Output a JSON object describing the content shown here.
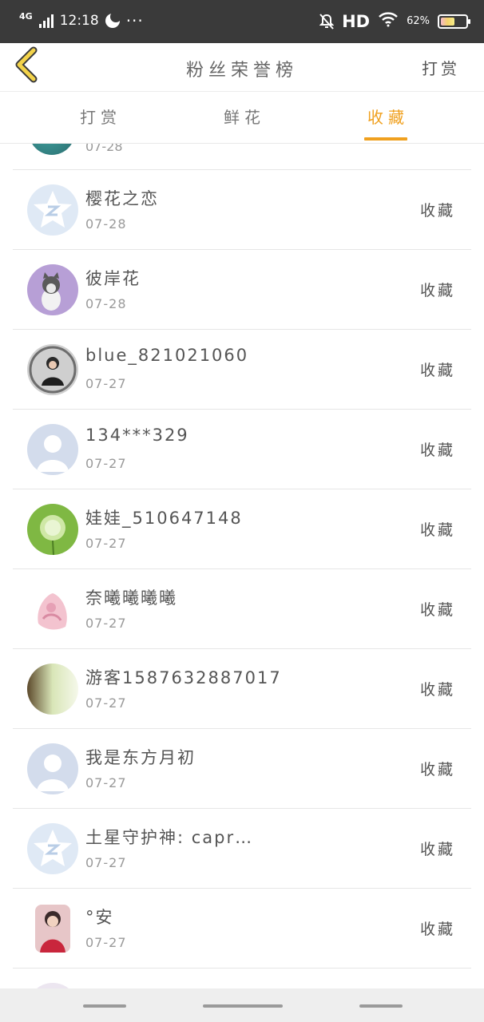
{
  "status_bar": {
    "network": "4G",
    "time": "12:18",
    "dots": "···",
    "hd": "HD",
    "battery_pct": "62%",
    "battery_level": 0.62
  },
  "header": {
    "title": "粉丝荣誉榜",
    "action": "打赏"
  },
  "tabs": [
    "打赏",
    "鲜花",
    "收藏"
  ],
  "active_tab": "收藏",
  "partial_top_date": "07-28",
  "rows": [
    {
      "name": "樱花之恋",
      "date": "07-28",
      "action": "收藏"
    },
    {
      "name": "彼岸花",
      "date": "07-28",
      "action": "收藏"
    },
    {
      "name": "blue_821021060",
      "date": "07-27",
      "action": "收藏"
    },
    {
      "name": "134***329",
      "date": "07-27",
      "action": "收藏"
    },
    {
      "name": "娃娃_510647148",
      "date": "07-27",
      "action": "收藏"
    },
    {
      "name": "奈曦曦曦曦",
      "date": "07-27",
      "action": "收藏"
    },
    {
      "name": "游客1587632887017",
      "date": "07-27",
      "action": "收藏"
    },
    {
      "name": "我是东方月初",
      "date": "07-27",
      "action": "收藏"
    },
    {
      "name": "土星守护神: capr…",
      "date": "07-27",
      "action": "收藏"
    },
    {
      "name": "°安",
      "date": "07-27",
      "action": "收藏"
    }
  ],
  "colors": {
    "accent": "#f0a01e",
    "status_bar": "#3a3a3a",
    "back_arrow": "#f3d34a"
  },
  "icons": {
    "back": "chevron-left-icon",
    "notifications_off": "bell-off-icon",
    "wifi": "wifi-icon",
    "battery": "battery-icon"
  }
}
